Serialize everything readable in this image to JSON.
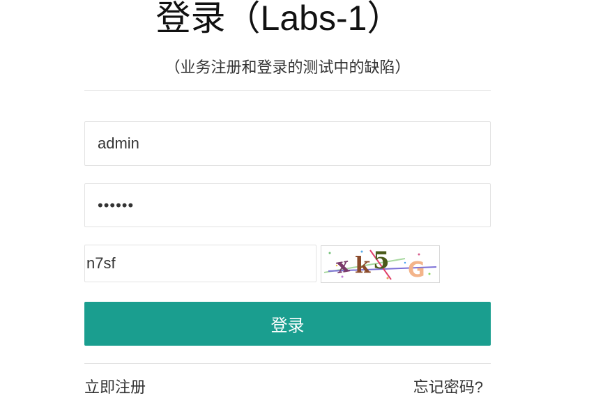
{
  "header": {
    "title": "登录（Labs-1）",
    "subtitle": "（业务注册和登录的测试中的缺陷）"
  },
  "form": {
    "username_value": "admin",
    "password_value": "••••••",
    "captcha_value": "n7sf",
    "captcha_image_text": "xk5 G",
    "login_label": "登录"
  },
  "footer": {
    "register_label": "立即注册",
    "forgot_label": "忘记密码?"
  },
  "colors": {
    "primary_button": "#1a9e8f",
    "border": "#e2e2e2"
  }
}
